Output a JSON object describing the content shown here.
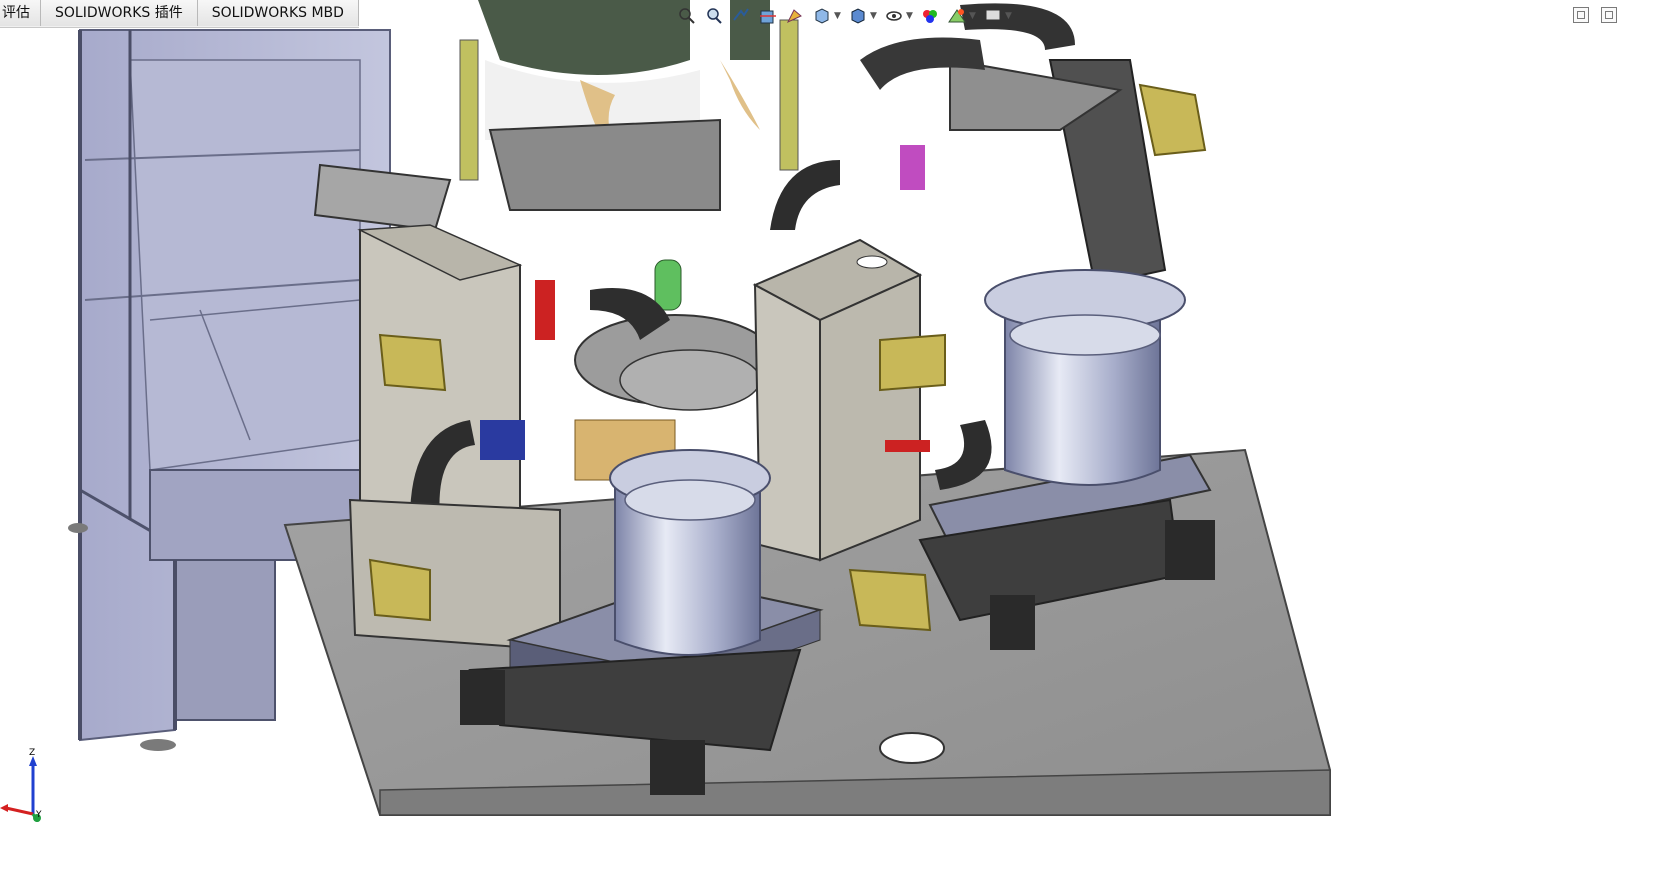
{
  "command_manager": {
    "tabs": [
      {
        "label": "评估"
      },
      {
        "label": "SOLIDWORKS 插件"
      },
      {
        "label": "SOLIDWORKS MBD"
      }
    ]
  },
  "heads_up_toolbar": {
    "icons": [
      "zoom-to-fit-icon",
      "zoom-to-area-icon",
      "previous-view-icon",
      "section-view-icon",
      "dynamic-annotation-icon",
      "view-orientation-icon",
      "display-style-icon",
      "hide-show-icon",
      "edit-appearance-icon",
      "apply-scene-icon",
      "view-settings-icon"
    ]
  },
  "triad": {
    "z_label": "Z",
    "y_label": "Y",
    "colors": {
      "x": "#d42020",
      "y": "#20a040",
      "z": "#2040d0"
    }
  },
  "colors": {
    "machine_grey": "#a9a9a9",
    "frame_glass": "#9da2c4",
    "bowl_steel": "#bfc4d8",
    "yellow_guard": "#c8b858",
    "dark_base": "#3c3c3c"
  }
}
